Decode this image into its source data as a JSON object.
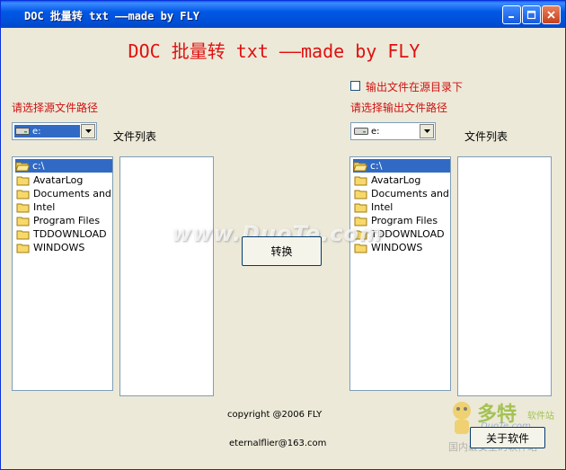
{
  "window": {
    "title": "DOC 批量转 txt ——made by FLY",
    "heading": "DOC 批量转 txt ——made by FLY"
  },
  "source": {
    "label": "请选择源文件路径",
    "drive": "e:",
    "file_list_label": "文件列表",
    "dirs": [
      "c:\\",
      "AvatarLog",
      "Documents and S",
      "Intel",
      "Program Files",
      "TDDOWNLOAD",
      "WINDOWS"
    ]
  },
  "output": {
    "checkbox_label": "输出文件在源目录下",
    "label": "请选择输出文件路径",
    "drive": "e:",
    "file_list_label": "文件列表",
    "dirs": [
      "c:\\",
      "AvatarLog",
      "Documents and S",
      "Intel",
      "Program Files",
      "TDDOWNLOAD",
      "WINDOWS"
    ]
  },
  "buttons": {
    "convert": "转换",
    "about": "关于软件"
  },
  "footer": {
    "copyright": "copyright @2006 FLY",
    "email": "eternalflier@163.com"
  },
  "watermark": {
    "site": "www.DuoTe.com",
    "logo_big": "多特",
    "logo_small": "软件站",
    "logo_site": "DuoTe.com",
    "logo_sub": "国内最安全的软件站"
  },
  "colors": {
    "title_bar": "#0054E3",
    "heading": "#E01010",
    "red_label": "#D01010",
    "selection": "#316AC5",
    "window_bg": "#ECE9D8"
  }
}
